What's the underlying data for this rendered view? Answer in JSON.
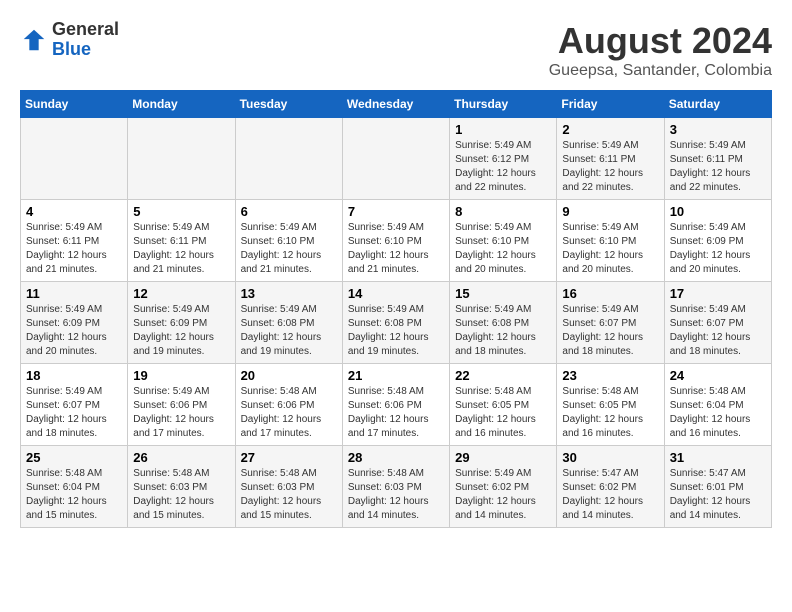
{
  "logo": {
    "text_general": "General",
    "text_blue": "Blue"
  },
  "header": {
    "month_year": "August 2024",
    "location": "Gueepsa, Santander, Colombia"
  },
  "days_of_week": [
    "Sunday",
    "Monday",
    "Tuesday",
    "Wednesday",
    "Thursday",
    "Friday",
    "Saturday"
  ],
  "weeks": [
    [
      {
        "day": "",
        "info": ""
      },
      {
        "day": "",
        "info": ""
      },
      {
        "day": "",
        "info": ""
      },
      {
        "day": "",
        "info": ""
      },
      {
        "day": "1",
        "info": "Sunrise: 5:49 AM\nSunset: 6:12 PM\nDaylight: 12 hours\nand 22 minutes."
      },
      {
        "day": "2",
        "info": "Sunrise: 5:49 AM\nSunset: 6:11 PM\nDaylight: 12 hours\nand 22 minutes."
      },
      {
        "day": "3",
        "info": "Sunrise: 5:49 AM\nSunset: 6:11 PM\nDaylight: 12 hours\nand 22 minutes."
      }
    ],
    [
      {
        "day": "4",
        "info": "Sunrise: 5:49 AM\nSunset: 6:11 PM\nDaylight: 12 hours\nand 21 minutes."
      },
      {
        "day": "5",
        "info": "Sunrise: 5:49 AM\nSunset: 6:11 PM\nDaylight: 12 hours\nand 21 minutes."
      },
      {
        "day": "6",
        "info": "Sunrise: 5:49 AM\nSunset: 6:10 PM\nDaylight: 12 hours\nand 21 minutes."
      },
      {
        "day": "7",
        "info": "Sunrise: 5:49 AM\nSunset: 6:10 PM\nDaylight: 12 hours\nand 21 minutes."
      },
      {
        "day": "8",
        "info": "Sunrise: 5:49 AM\nSunset: 6:10 PM\nDaylight: 12 hours\nand 20 minutes."
      },
      {
        "day": "9",
        "info": "Sunrise: 5:49 AM\nSunset: 6:10 PM\nDaylight: 12 hours\nand 20 minutes."
      },
      {
        "day": "10",
        "info": "Sunrise: 5:49 AM\nSunset: 6:09 PM\nDaylight: 12 hours\nand 20 minutes."
      }
    ],
    [
      {
        "day": "11",
        "info": "Sunrise: 5:49 AM\nSunset: 6:09 PM\nDaylight: 12 hours\nand 20 minutes."
      },
      {
        "day": "12",
        "info": "Sunrise: 5:49 AM\nSunset: 6:09 PM\nDaylight: 12 hours\nand 19 minutes."
      },
      {
        "day": "13",
        "info": "Sunrise: 5:49 AM\nSunset: 6:08 PM\nDaylight: 12 hours\nand 19 minutes."
      },
      {
        "day": "14",
        "info": "Sunrise: 5:49 AM\nSunset: 6:08 PM\nDaylight: 12 hours\nand 19 minutes."
      },
      {
        "day": "15",
        "info": "Sunrise: 5:49 AM\nSunset: 6:08 PM\nDaylight: 12 hours\nand 18 minutes."
      },
      {
        "day": "16",
        "info": "Sunrise: 5:49 AM\nSunset: 6:07 PM\nDaylight: 12 hours\nand 18 minutes."
      },
      {
        "day": "17",
        "info": "Sunrise: 5:49 AM\nSunset: 6:07 PM\nDaylight: 12 hours\nand 18 minutes."
      }
    ],
    [
      {
        "day": "18",
        "info": "Sunrise: 5:49 AM\nSunset: 6:07 PM\nDaylight: 12 hours\nand 18 minutes."
      },
      {
        "day": "19",
        "info": "Sunrise: 5:49 AM\nSunset: 6:06 PM\nDaylight: 12 hours\nand 17 minutes."
      },
      {
        "day": "20",
        "info": "Sunrise: 5:48 AM\nSunset: 6:06 PM\nDaylight: 12 hours\nand 17 minutes."
      },
      {
        "day": "21",
        "info": "Sunrise: 5:48 AM\nSunset: 6:06 PM\nDaylight: 12 hours\nand 17 minutes."
      },
      {
        "day": "22",
        "info": "Sunrise: 5:48 AM\nSunset: 6:05 PM\nDaylight: 12 hours\nand 16 minutes."
      },
      {
        "day": "23",
        "info": "Sunrise: 5:48 AM\nSunset: 6:05 PM\nDaylight: 12 hours\nand 16 minutes."
      },
      {
        "day": "24",
        "info": "Sunrise: 5:48 AM\nSunset: 6:04 PM\nDaylight: 12 hours\nand 16 minutes."
      }
    ],
    [
      {
        "day": "25",
        "info": "Sunrise: 5:48 AM\nSunset: 6:04 PM\nDaylight: 12 hours\nand 15 minutes."
      },
      {
        "day": "26",
        "info": "Sunrise: 5:48 AM\nSunset: 6:03 PM\nDaylight: 12 hours\nand 15 minutes."
      },
      {
        "day": "27",
        "info": "Sunrise: 5:48 AM\nSunset: 6:03 PM\nDaylight: 12 hours\nand 15 minutes."
      },
      {
        "day": "28",
        "info": "Sunrise: 5:48 AM\nSunset: 6:03 PM\nDaylight: 12 hours\nand 14 minutes."
      },
      {
        "day": "29",
        "info": "Sunrise: 5:49 AM\nSunset: 6:02 PM\nDaylight: 12 hours\nand 14 minutes."
      },
      {
        "day": "30",
        "info": "Sunrise: 5:47 AM\nSunset: 6:02 PM\nDaylight: 12 hours\nand 14 minutes."
      },
      {
        "day": "31",
        "info": "Sunrise: 5:47 AM\nSunset: 6:01 PM\nDaylight: 12 hours\nand 14 minutes."
      }
    ]
  ]
}
